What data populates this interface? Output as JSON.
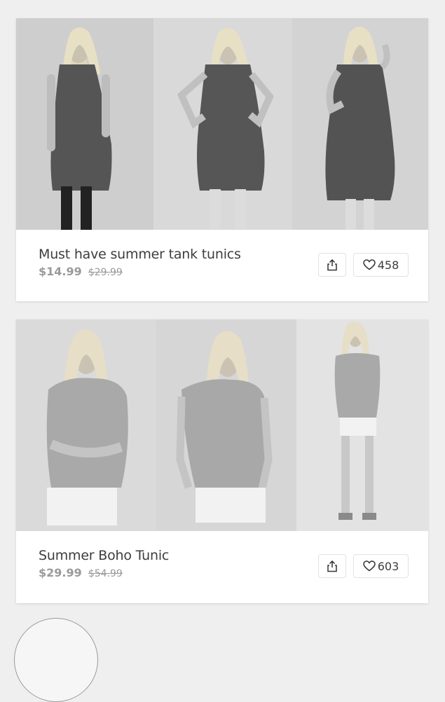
{
  "products": [
    {
      "title": "Must have summer tank tunics",
      "price": "$14.99",
      "original_price": "$29.99",
      "likes": "458",
      "share_icon": "share-icon",
      "like_icon": "heart-icon",
      "photos": [
        "model-front-leggings",
        "model-hands-on-hips",
        "model-hand-in-hair"
      ]
    },
    {
      "title": "Summer Boho Tunic",
      "price": "$29.99",
      "original_price": "$54.99",
      "likes": "603",
      "share_icon": "share-icon",
      "like_icon": "heart-icon",
      "photos": [
        "model-arms-crossed",
        "model-hand-at-side",
        "model-full-length"
      ]
    }
  ]
}
